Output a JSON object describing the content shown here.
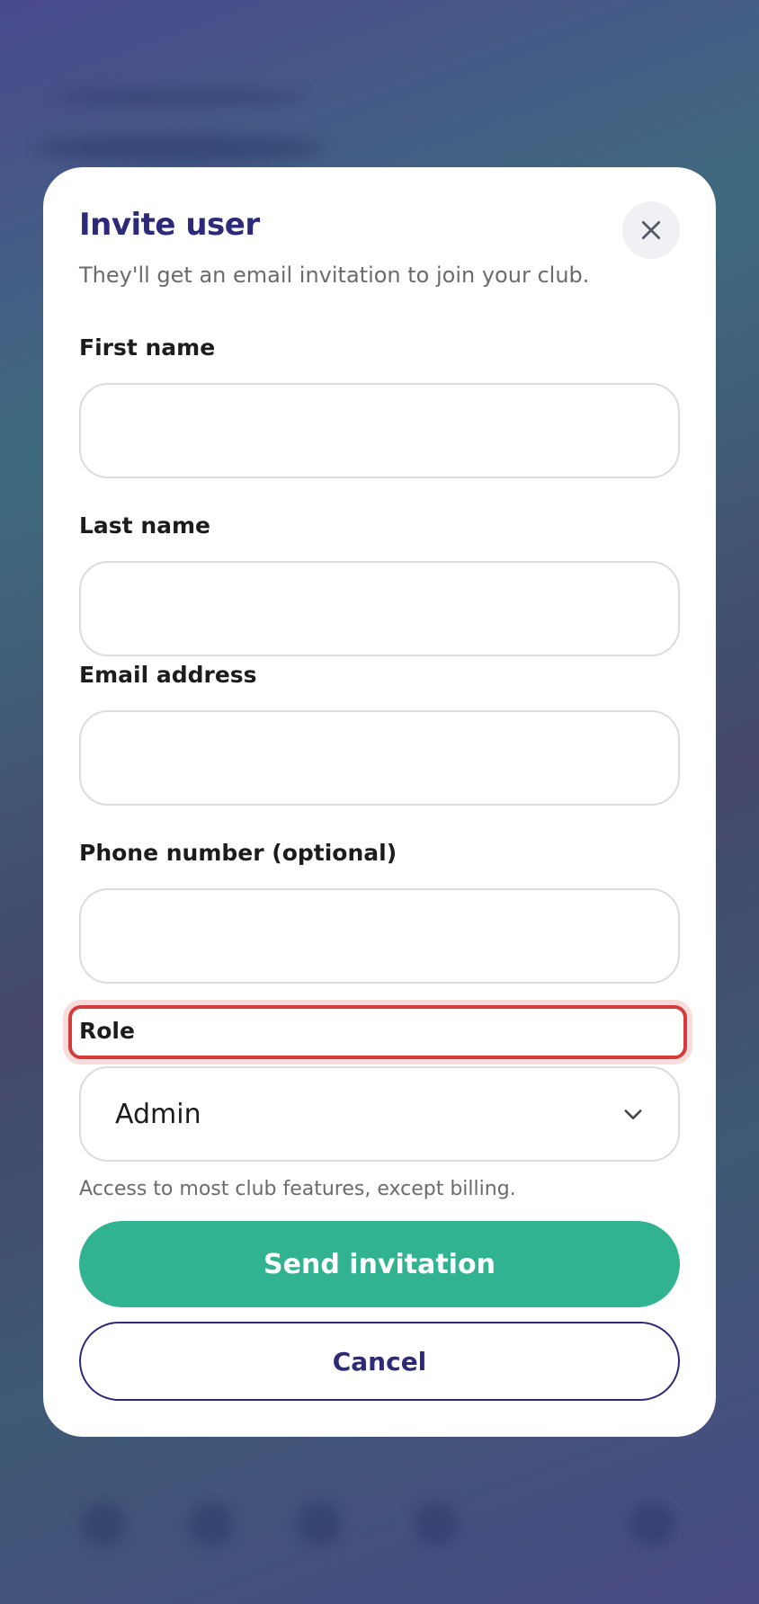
{
  "modal": {
    "title": "Invite user",
    "subtitle": "They'll get an email invitation to join your club.",
    "close_icon": "close-icon"
  },
  "fields": {
    "first_name": {
      "label": "First name",
      "value": ""
    },
    "last_name": {
      "label": "Last name",
      "value": ""
    },
    "email": {
      "label": "Email address",
      "value": ""
    },
    "phone": {
      "label": "Phone number (optional)",
      "value": ""
    },
    "role": {
      "label": "Role",
      "value": "Admin",
      "helper": "Access to most club features, except billing.",
      "icon": "chevron-down-icon"
    }
  },
  "actions": {
    "send_label": "Send invitation",
    "cancel_label": "Cancel"
  },
  "colors": {
    "title": "#2d2a7a",
    "primary": "#31b391",
    "highlight": "#d63b3b"
  }
}
